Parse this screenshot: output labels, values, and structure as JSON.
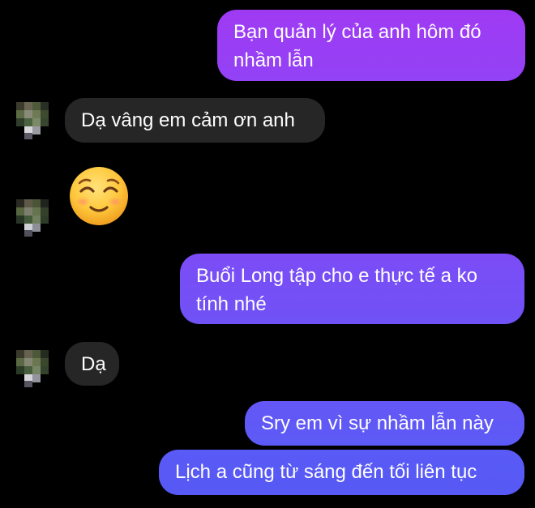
{
  "chat": {
    "messages": [
      {
        "id": "m1",
        "direction": "outgoing",
        "lines": [
          "Bạn quản lý của anh hôm đó",
          "nhầm lẫn"
        ]
      },
      {
        "id": "m2",
        "direction": "incoming",
        "lines": [
          "Dạ vâng em cảm ơn anh"
        ]
      },
      {
        "id": "m3",
        "direction": "incoming",
        "emoji": "smiling-face-with-smiling-eyes"
      },
      {
        "id": "m4",
        "direction": "outgoing",
        "lines": [
          "Buổi Long tập cho e thực tế a ko",
          "tính nhé"
        ]
      },
      {
        "id": "m5",
        "direction": "incoming",
        "lines": [
          "Dạ"
        ]
      },
      {
        "id": "m6",
        "direction": "outgoing",
        "lines": [
          "Sry em vì sự nhầm lẫn này"
        ]
      },
      {
        "id": "m7",
        "direction": "outgoing",
        "lines": [
          "Lịch a cũng từ sáng đến tối liên tục"
        ]
      }
    ]
  },
  "colors": {
    "background": "#000000",
    "incoming_bubble": "#262626",
    "outgoing_gradient_top": "#9a3cf4",
    "outgoing_gradient_mid": "#7c4df7",
    "outgoing_gradient_bottom": "#5a58f5",
    "text": "#ffffff"
  }
}
